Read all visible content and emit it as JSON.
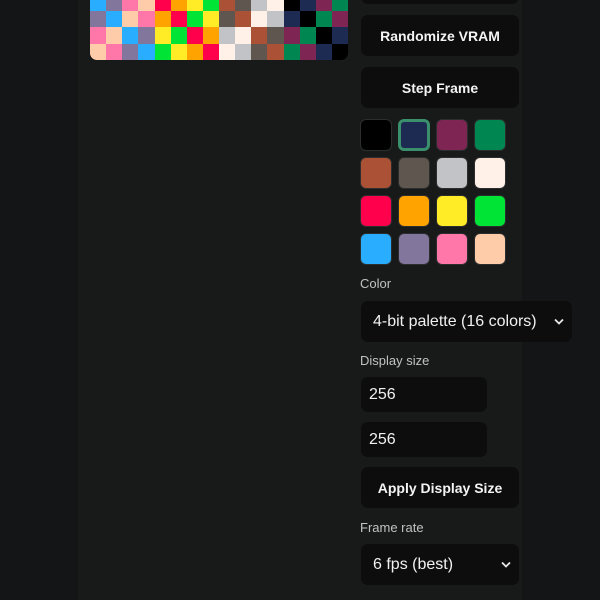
{
  "vram": {
    "pixels": [
      "#29adff",
      "#83769c",
      "#ff77a8",
      "#ffccaa",
      "#ff004d",
      "#ffa300",
      "#ffec27",
      "#00e436",
      "#ab5236",
      "#5f574f",
      "#c2c3c7",
      "#fff1e8",
      "#000000",
      "#1d2b53",
      "#7e2553",
      "#008751",
      "#83769c",
      "#29adff",
      "#ffccaa",
      "#ff77a8",
      "#ffa300",
      "#ff004d",
      "#00e436",
      "#ffec27",
      "#5f574f",
      "#ab5236",
      "#fff1e8",
      "#c2c3c7",
      "#1d2b53",
      "#000000",
      "#008751",
      "#7e2553",
      "#ff77a8",
      "#ffccaa",
      "#29adff",
      "#83769c",
      "#ffec27",
      "#00e436",
      "#ff004d",
      "#ffa300",
      "#c2c3c7",
      "#fff1e8",
      "#ab5236",
      "#5f574f",
      "#7e2553",
      "#008751",
      "#000000",
      "#1d2b53",
      "#ffccaa",
      "#ff77a8",
      "#83769c",
      "#29adff",
      "#00e436",
      "#ffec27",
      "#ffa300",
      "#ff004d",
      "#fff1e8",
      "#c2c3c7",
      "#5f574f",
      "#ab5236",
      "#008751",
      "#7e2553",
      "#1d2b53",
      "#000000"
    ]
  },
  "buttons": {
    "randomize": "Randomize VRAM",
    "step": "Step Frame",
    "apply_size": "Apply Display Size"
  },
  "palette": [
    {
      "color": "#000000",
      "selected": false
    },
    {
      "color": "#1d2b53",
      "selected": true
    },
    {
      "color": "#7e2553",
      "selected": false
    },
    {
      "color": "#008751",
      "selected": false
    },
    {
      "color": "#ab5236",
      "selected": false
    },
    {
      "color": "#5f574f",
      "selected": false
    },
    {
      "color": "#c2c3c7",
      "selected": false
    },
    {
      "color": "#fff1e8",
      "selected": false
    },
    {
      "color": "#ff004d",
      "selected": false
    },
    {
      "color": "#ffa300",
      "selected": false
    },
    {
      "color": "#ffec27",
      "selected": false
    },
    {
      "color": "#00e436",
      "selected": false
    },
    {
      "color": "#29adff",
      "selected": false
    },
    {
      "color": "#83769c",
      "selected": false
    },
    {
      "color": "#ff77a8",
      "selected": false
    },
    {
      "color": "#ffccaa",
      "selected": false
    }
  ],
  "color": {
    "label": "Color",
    "selected": "4-bit palette (16 colors)"
  },
  "display_size": {
    "label": "Display size",
    "width_value": "256",
    "height_value": "256"
  },
  "frame_rate": {
    "label": "Frame rate",
    "selected": "6 fps (best)"
  }
}
